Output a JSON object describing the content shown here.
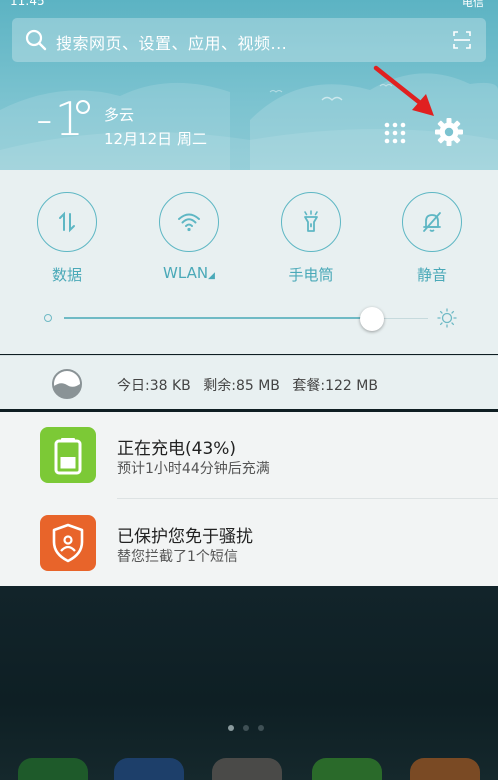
{
  "status_bar": {
    "time": "11:45",
    "right": "电信"
  },
  "search": {
    "placeholder": "搜索网页、设置、应用、视频..."
  },
  "weather": {
    "temperature": "-1",
    "condition": "多云",
    "date": "12月12日 周二"
  },
  "quick_settings": {
    "tiles": [
      {
        "label": "数据",
        "icon": "data-transfer-icon"
      },
      {
        "label": "WLAN",
        "icon": "wifi-icon"
      },
      {
        "label": "手电筒",
        "icon": "flashlight-icon"
      },
      {
        "label": "静音",
        "icon": "mute-bell-icon"
      }
    ],
    "brightness_level": 0.86
  },
  "data_usage": {
    "today": "今日:38 KB",
    "remaining": "剩余:85 MB",
    "plan": "套餐:122 MB"
  },
  "notifications": [
    {
      "title": "正在充电(43%)",
      "subtitle": "预计1小时44分钟后充满",
      "icon": "battery-icon",
      "color": "#7cc936"
    },
    {
      "title": "已保护您免于骚扰",
      "subtitle": "替您拦截了1个短信",
      "icon": "shield-icon",
      "color": "#e8642a"
    }
  ],
  "colors": {
    "accent": "#5eb7c4",
    "header_bg": "#6cbccb",
    "annotation_arrow": "#e02020"
  }
}
